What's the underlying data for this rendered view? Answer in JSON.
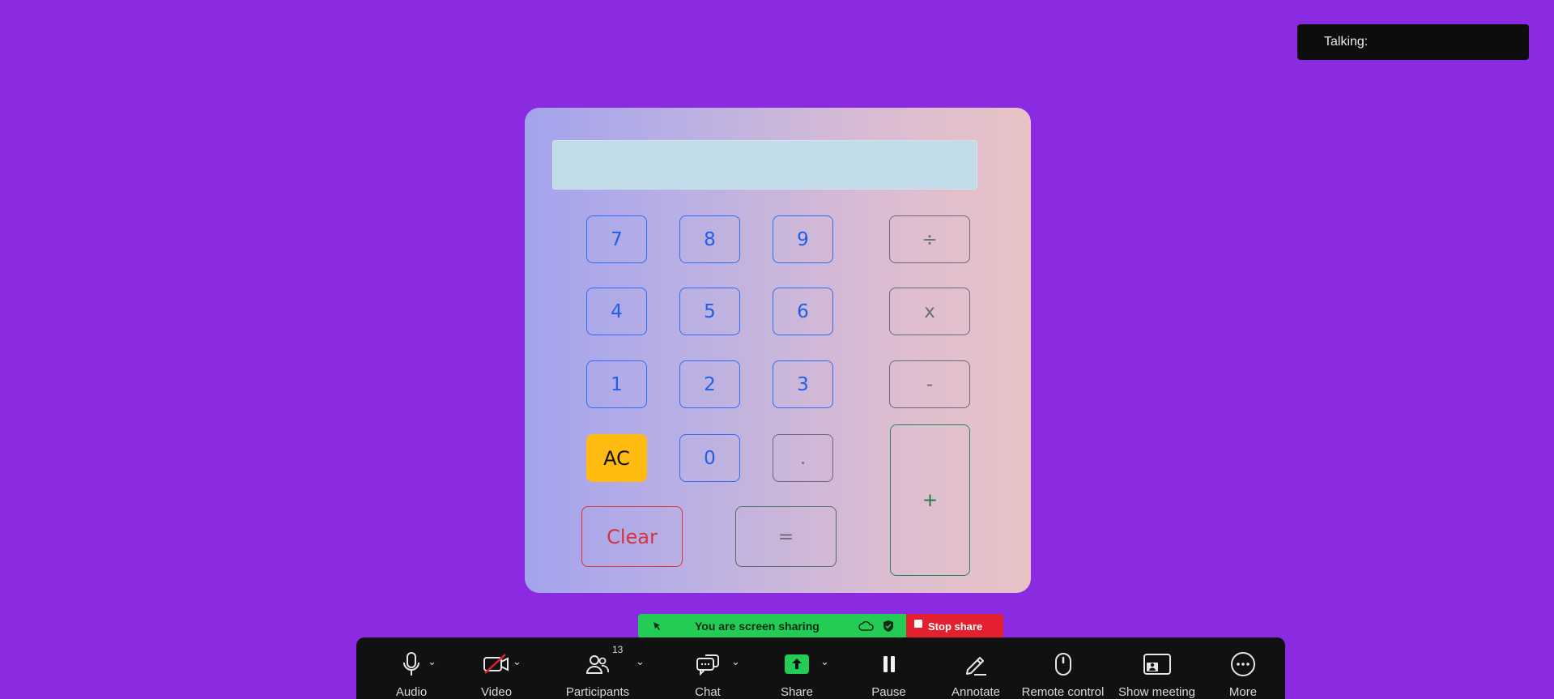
{
  "talking": {
    "label": "Talking:"
  },
  "calculator": {
    "display_value": "",
    "keys": {
      "k7": "7",
      "k8": "8",
      "k9": "9",
      "div": "÷",
      "k4": "4",
      "k5": "5",
      "k6": "6",
      "mul": "x",
      "k1": "1",
      "k2": "2",
      "k3": "3",
      "sub": "-",
      "ac": "AC",
      "k0": "0",
      "dot": ".",
      "add": "+",
      "clear": "Clear",
      "equals": "="
    },
    "colors": {
      "number_border": "#2f6df2",
      "ac_bg": "#ffbb0f",
      "clear_border": "#e0303a",
      "plus_border": "#1c8a56"
    }
  },
  "share_banner": {
    "text": "You are screen sharing",
    "stop_label": "Stop share",
    "color": "#22cc55",
    "stop_color": "#e5202e"
  },
  "toolbar": {
    "audio": "Audio",
    "video": "Video",
    "participants": "Participants",
    "participants_count": "13",
    "chat": "Chat",
    "share": "Share",
    "pause": "Pause",
    "annotate": "Annotate",
    "remote_control": "Remote control",
    "show_meeting": "Show meeting",
    "more": "More",
    "icons": [
      "microphone-icon",
      "video-off-icon",
      "participants-icon",
      "chat-icon",
      "share-screen-icon",
      "pause-icon",
      "pencil-icon",
      "mouse-icon",
      "show-meeting-icon",
      "more-icon"
    ]
  }
}
